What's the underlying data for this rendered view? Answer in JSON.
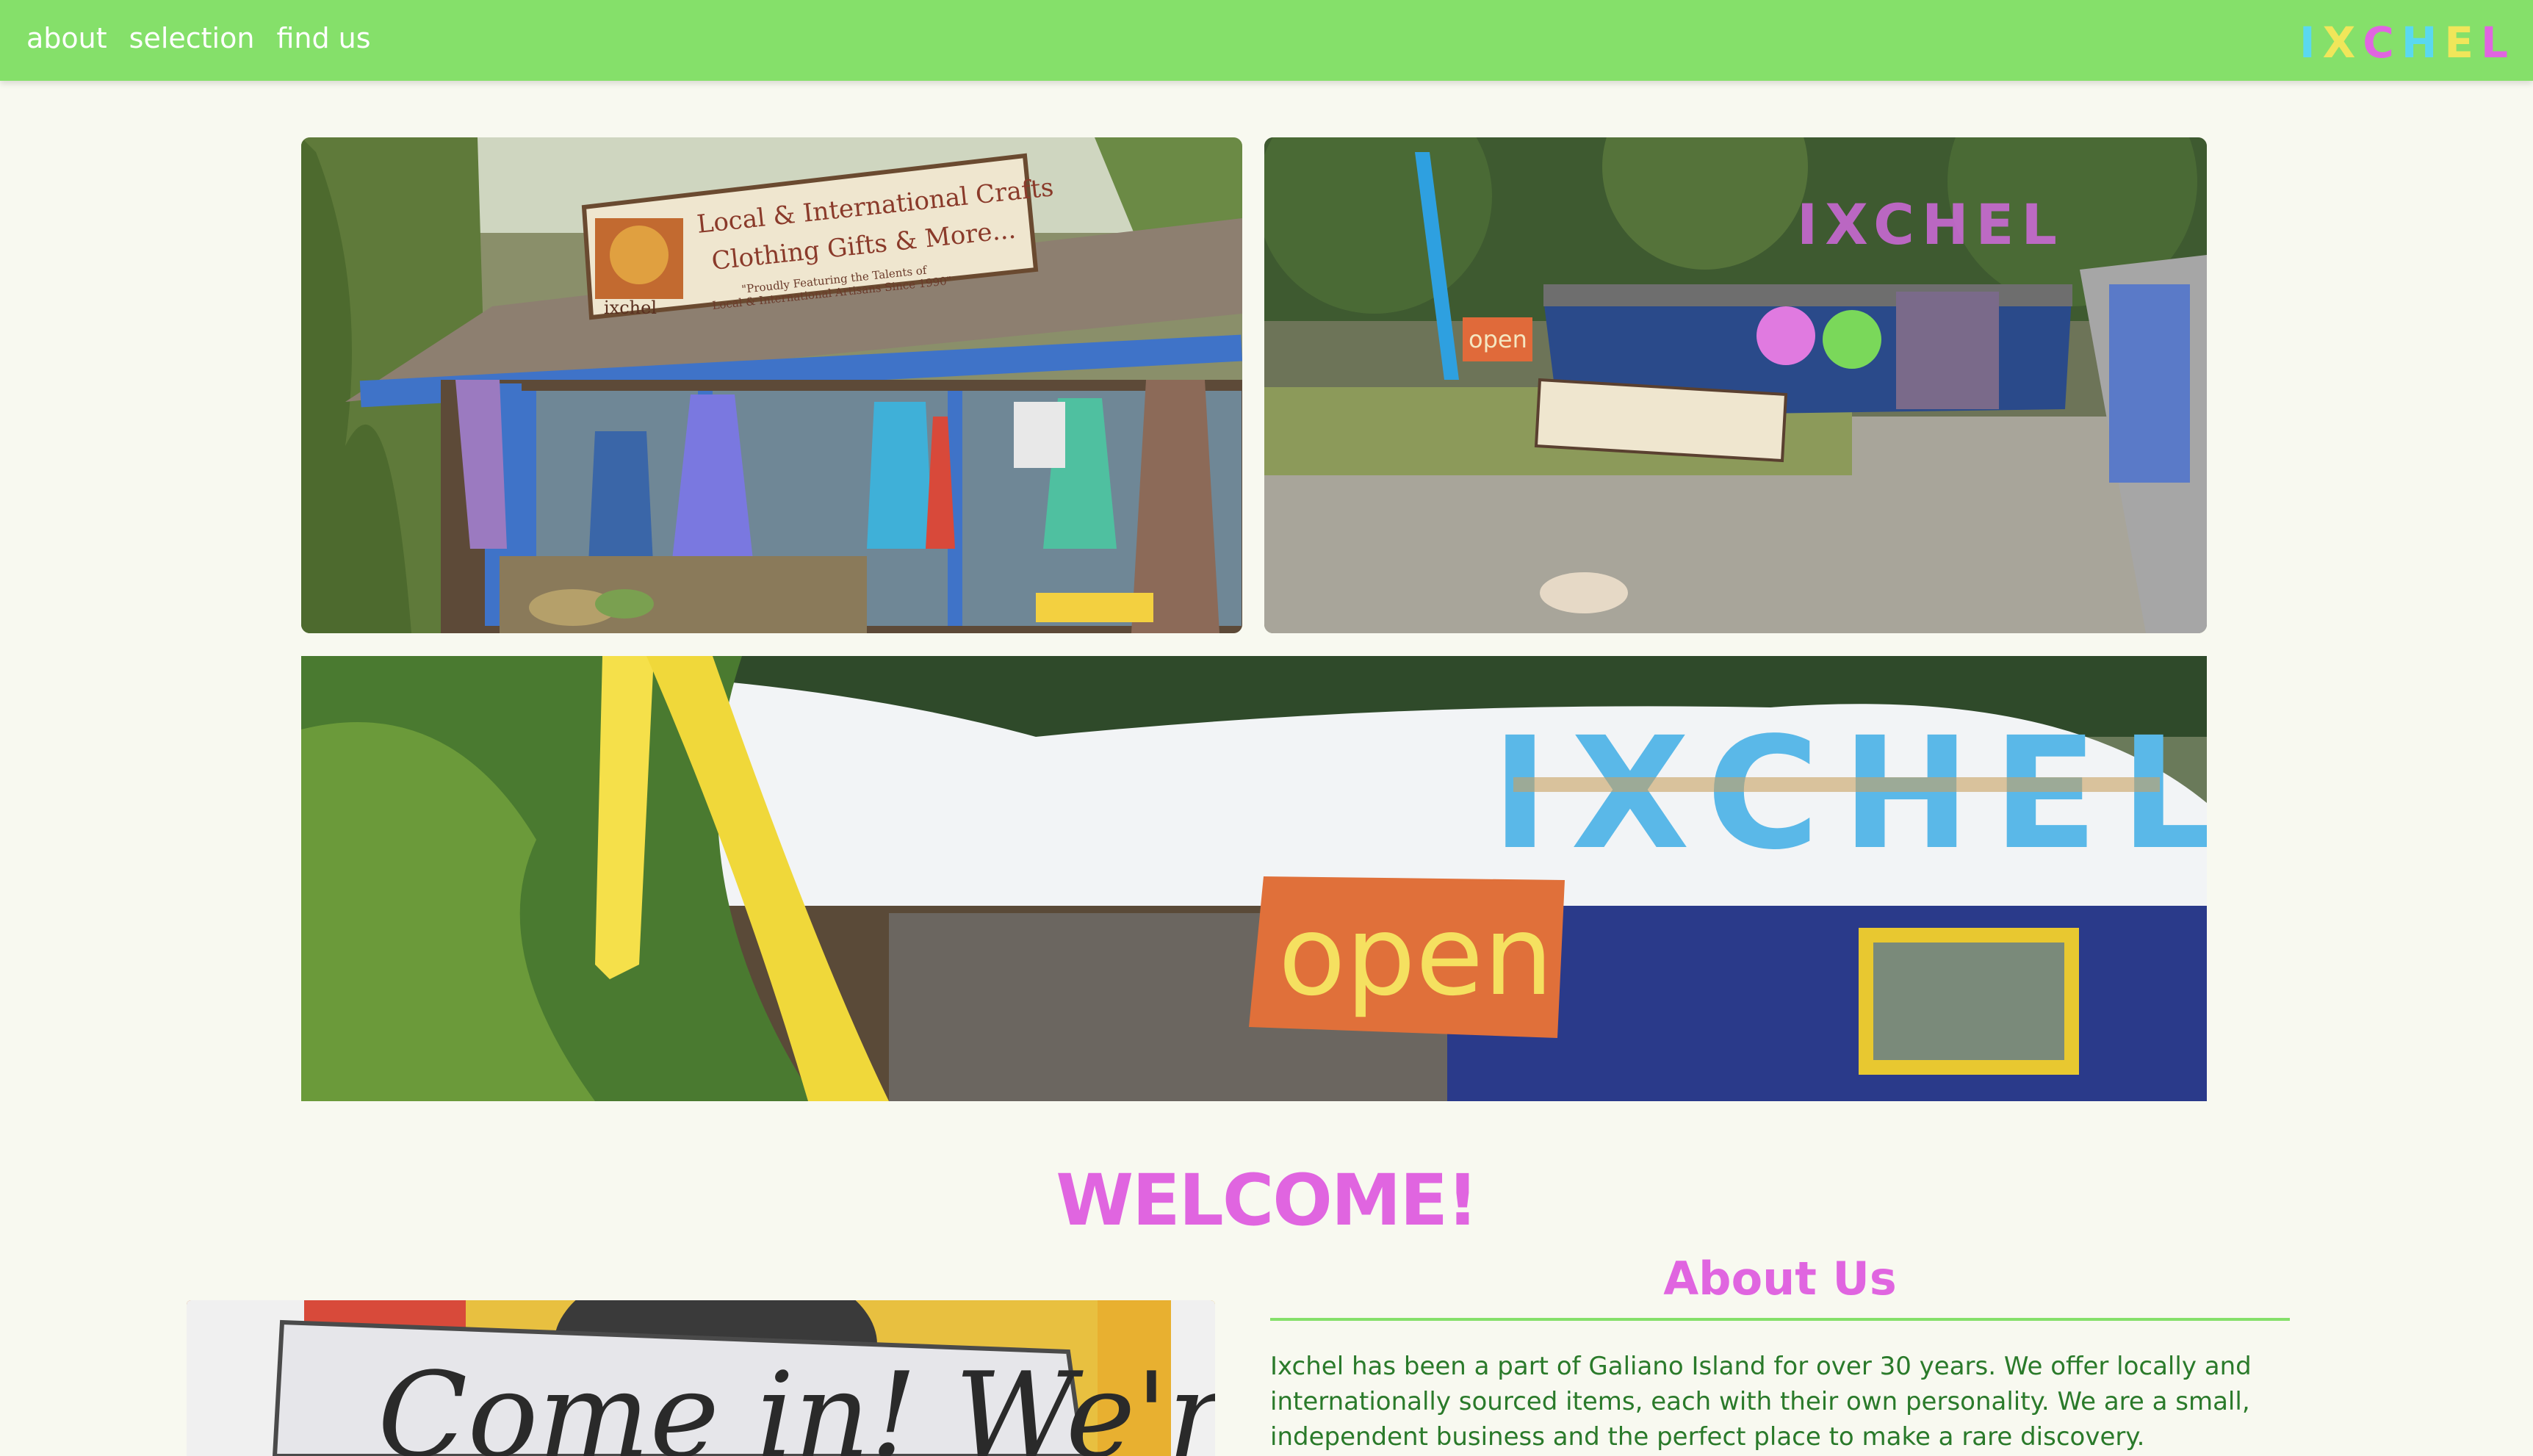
{
  "nav": {
    "links": [
      "about",
      "selection",
      "find us"
    ]
  },
  "logo": {
    "letters": [
      {
        "char": "I",
        "color": "#5ad8f0"
      },
      {
        "char": "X",
        "color": "#f0e65a"
      },
      {
        "char": "C",
        "color": "#e065e0"
      },
      {
        "char": "H",
        "color": "#5ad8f0"
      },
      {
        "char": "E",
        "color": "#f0e65a"
      },
      {
        "char": "L",
        "color": "#e065e0"
      }
    ]
  },
  "photos": {
    "storefront_sign_line1": "Local & International Crafts",
    "storefront_sign_line2": "Clothing Gifts & More...",
    "storefront_sign_line3": "\"Proudly Featuring the Talents of",
    "storefront_sign_line4": "Local & International Artisans Since 1990\"",
    "storefront_sign_brand": "ixchel",
    "yard_open_sign": "open",
    "yard_letters": "IXCHEL",
    "snow_letters": "IXCHEL",
    "snow_open_sign": "open",
    "come_in_sign": "Come in! We're"
  },
  "welcome": "WELCOME!",
  "about": {
    "title": "About Us",
    "text": "Ixchel has been a part of Galiano Island for over 30 years. We offer locally and internationally sourced items, each with their own personality. We are a small, independent business and the perfect place to make a rare discovery."
  },
  "colors": {
    "nav_bg": "#85e06a",
    "accent_pink": "#e065e0",
    "text_green": "#2a7a2a",
    "page_bg": "#f8f9f0"
  }
}
